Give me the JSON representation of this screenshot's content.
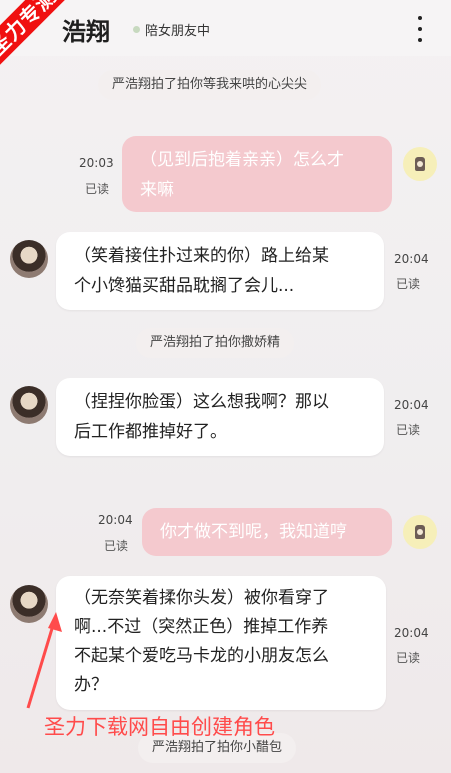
{
  "header": {
    "title": "浩翔",
    "status": "陪女朋友中",
    "status_color": "#c7d9bf",
    "more_icon": "more-vertical-icon"
  },
  "watermark": {
    "corner_text": "圣力专测",
    "corner_color": "#f01010",
    "promo_text": "圣力下载网自由创建角色",
    "promo_color": "#ff4b4b"
  },
  "messages": [
    {
      "type": "system",
      "text": "严浩翔拍了拍你等我来哄的心尖尖"
    },
    {
      "type": "outgoing",
      "lines": [
        "（见到后抱着亲亲）怎么才",
        "来嘛"
      ],
      "time": "20:03",
      "read": "已读"
    },
    {
      "type": "incoming",
      "lines": [
        "（笑着接住扑过来的你）路上给某",
        "个小馋猫买甜品耽搁了会儿..."
      ],
      "time": "20:04",
      "read": "已读"
    },
    {
      "type": "system",
      "text": "严浩翔拍了拍你撒娇精"
    },
    {
      "type": "incoming",
      "lines": [
        "（捏捏你脸蛋）这么想我啊？那以",
        "后工作都推掉好了。"
      ],
      "time": "20:04",
      "read": "已读"
    },
    {
      "type": "outgoing",
      "lines": [
        "你才做不到呢，我知道哼"
      ],
      "time": "20:04",
      "read": "已读"
    },
    {
      "type": "incoming",
      "lines": [
        "（无奈笑着揉你头发）被你看穿了",
        "啊...不过（突然正色）推掉工作养",
        "不起某个爱吃马卡龙的小朋友怎么",
        "办？"
      ],
      "time": "20:04",
      "read": "已读"
    },
    {
      "type": "system",
      "text": "严浩翔拍了拍你小醋包"
    }
  ]
}
